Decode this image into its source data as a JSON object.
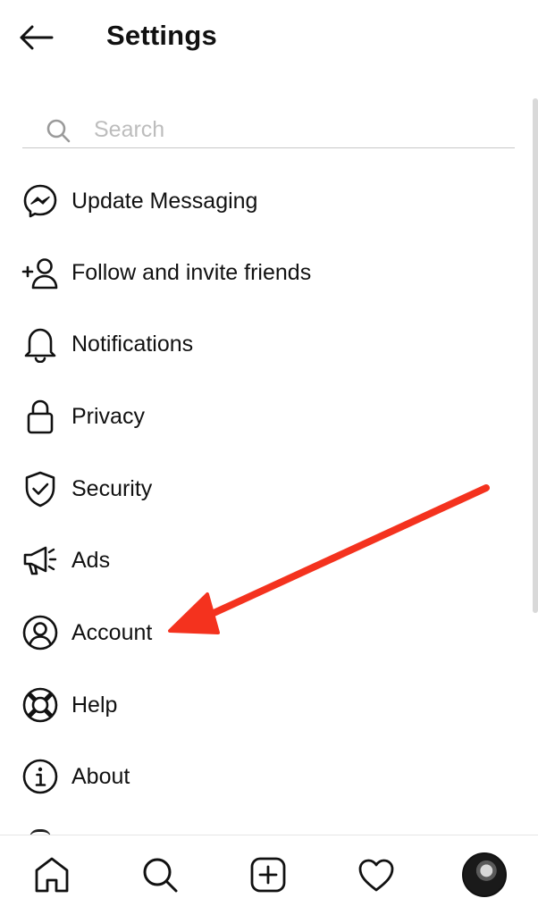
{
  "header": {
    "title": "Settings"
  },
  "search": {
    "placeholder": "Search"
  },
  "menu": {
    "items": [
      {
        "label": "Update Messaging",
        "icon": "messenger-icon"
      },
      {
        "label": "Follow and invite friends",
        "icon": "add-person-icon"
      },
      {
        "label": "Notifications",
        "icon": "bell-icon"
      },
      {
        "label": "Privacy",
        "icon": "lock-icon"
      },
      {
        "label": "Security",
        "icon": "shield-check-icon"
      },
      {
        "label": "Ads",
        "icon": "megaphone-icon"
      },
      {
        "label": "Account",
        "icon": "account-circle-icon"
      },
      {
        "label": "Help",
        "icon": "lifebuoy-icon"
      },
      {
        "label": "About",
        "icon": "info-icon"
      }
    ]
  },
  "bottom_nav": {
    "items": [
      "home-icon",
      "search-icon",
      "add-post-icon",
      "heart-icon",
      "profile-avatar"
    ]
  },
  "annotation": {
    "arrow_color": "#f4321e"
  }
}
